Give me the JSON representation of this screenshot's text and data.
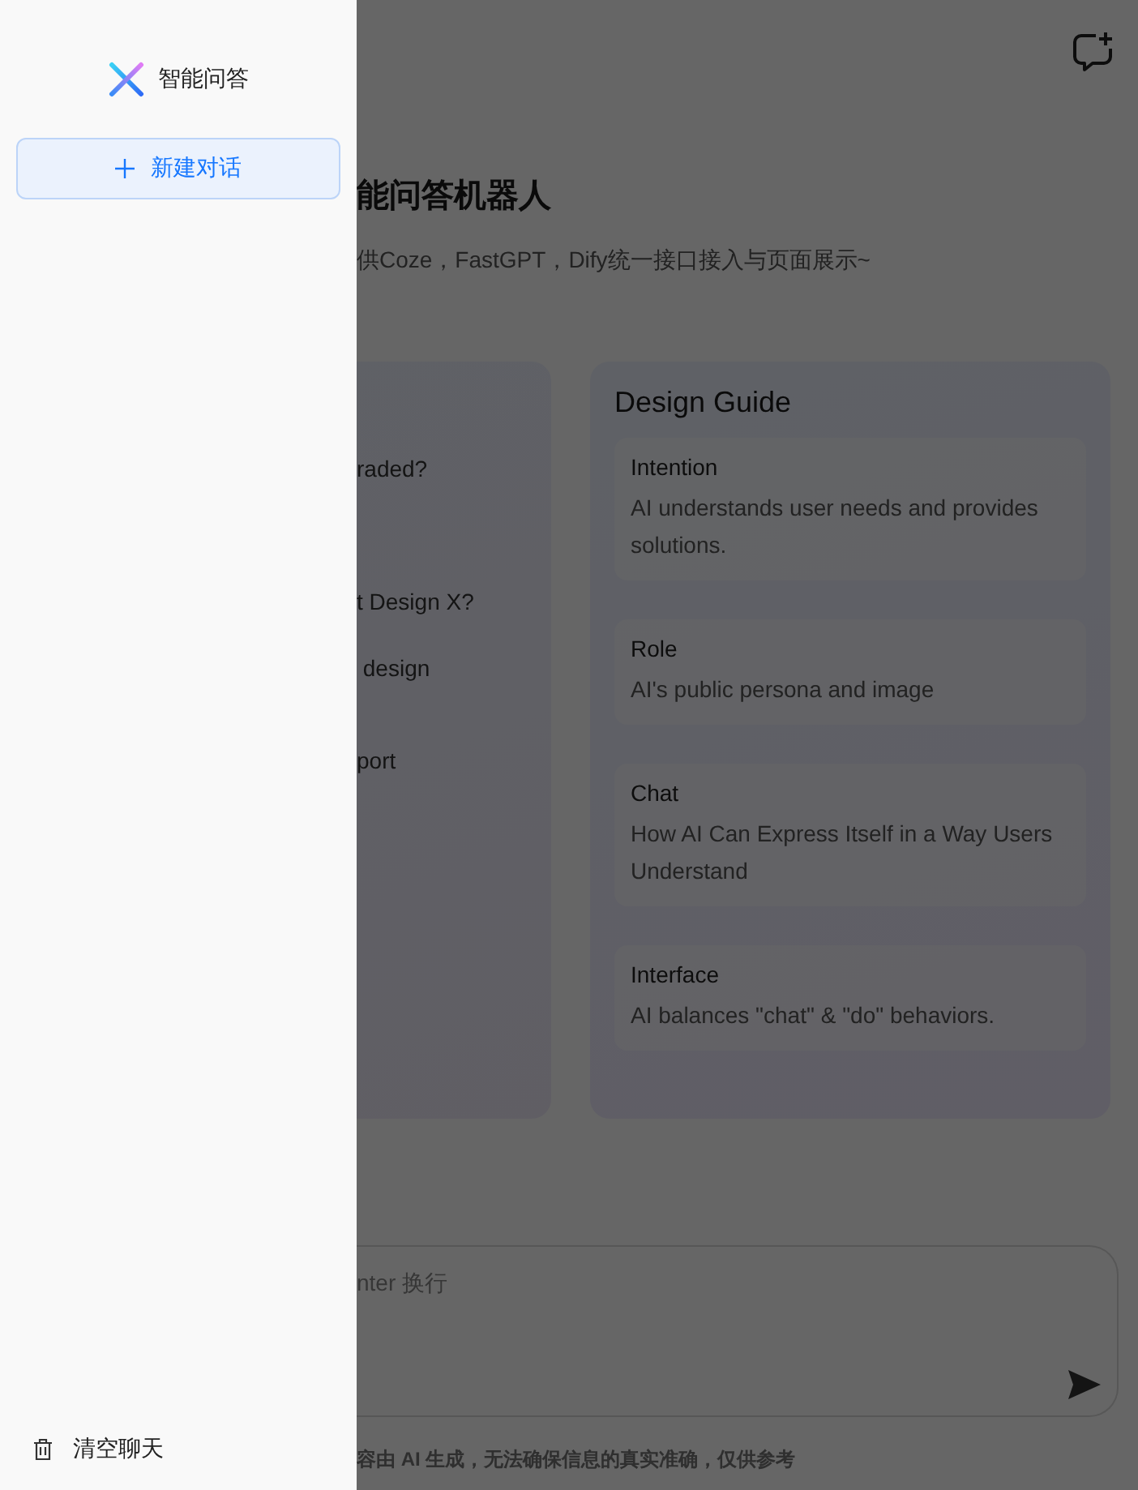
{
  "sidebar": {
    "title": "智能问答",
    "new_chat_button": "新建对话",
    "clear_button": "清空聊天"
  },
  "main": {
    "title": "能问答机器人",
    "subtitle": "供Coze，FastGPT，Dify统一接口接入与页面展示~",
    "prompt_card": {
      "items": [
        "raded?",
        "t Design X?",
        " design",
        "port"
      ]
    },
    "guide": {
      "title": "Design Guide",
      "items": [
        {
          "title": "Intention",
          "description": "AI understands user needs and provides solutions."
        },
        {
          "title": "Role",
          "description": "AI's public persona and image"
        },
        {
          "title": "Chat",
          "description": "How AI Can Express Itself in a Way Users Understand"
        },
        {
          "title": "Interface",
          "description": "AI balances \"chat\" & \"do\" behaviors."
        }
      ]
    },
    "input": {
      "placeholder": "nter 换行"
    },
    "disclaimer": "容由 AI 生成，无法确保信息的真实准确，仅供参考"
  }
}
